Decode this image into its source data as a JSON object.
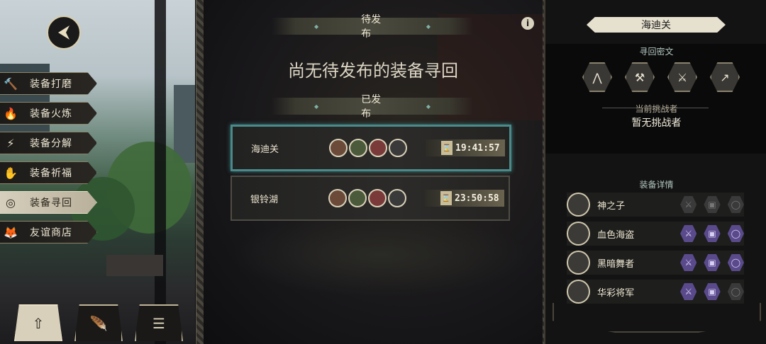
{
  "menu": {
    "items": [
      {
        "label": "装备打磨",
        "icon": "hammer-icon",
        "glyph": "🔨",
        "active": false
      },
      {
        "label": "装备火炼",
        "icon": "flame-icon",
        "glyph": "🔥",
        "active": false
      },
      {
        "label": "装备分解",
        "icon": "decompose-icon",
        "glyph": "⚡",
        "active": false
      },
      {
        "label": "装备祈福",
        "icon": "hand-icon",
        "glyph": "✋",
        "active": false
      },
      {
        "label": "装备寻回",
        "icon": "target-icon",
        "glyph": "◎",
        "active": true
      },
      {
        "label": "友谊商店",
        "icon": "fox-icon",
        "glyph": "🦊",
        "active": false
      }
    ]
  },
  "tabs": [
    {
      "icon": "upload-icon",
      "glyph": "⇧",
      "active": true
    },
    {
      "icon": "feather-icon",
      "glyph": "🪶",
      "active": false
    },
    {
      "icon": "list-icon",
      "glyph": "☰",
      "active": false
    }
  ],
  "center": {
    "pending_header": "待发布",
    "pending_empty": "尚无待发布的装备寻回",
    "published_header": "已发布",
    "info_icon": "i",
    "bounties": [
      {
        "name": "海迪关",
        "timer": "19:41:57",
        "selected": true
      },
      {
        "name": "银铃湖",
        "timer": "23:50:58",
        "selected": false
      }
    ]
  },
  "right": {
    "title": "海迪关",
    "cipher_label": "寻回密文",
    "ciphers": [
      "⋀",
      "⚒",
      "⚔",
      "↗"
    ],
    "challenger_label": "当前挑战者",
    "challenger_value": "暂无挑战者",
    "details_label": "装备详情",
    "equipment": [
      {
        "name": "神之子",
        "slots": [
          false,
          false,
          false
        ]
      },
      {
        "name": "血色海盗",
        "slots": [
          true,
          true,
          true
        ]
      },
      {
        "name": "黑暗舞者",
        "slots": [
          true,
          true,
          true
        ]
      },
      {
        "name": "华彩将军",
        "slots": [
          true,
          true,
          false
        ]
      }
    ]
  },
  "colors": {
    "accent_teal": "#4a8a8a",
    "slot_active": "#5a4a8c"
  }
}
